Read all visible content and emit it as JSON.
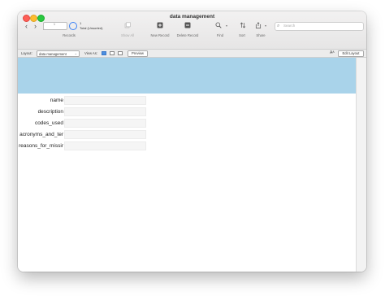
{
  "window": {
    "title": "data management"
  },
  "toolbar": {
    "record_current": "1",
    "record_total": "Total (Unsorted)",
    "records_label": "Records",
    "show_all_label": "Show All",
    "new_record_label": "New Record",
    "delete_record_label": "Delete Record",
    "find_label": "Find",
    "sort_label": "Sort",
    "share_label": "Share",
    "search_placeholder": "Search"
  },
  "layout_bar": {
    "layout_label": "Layout:",
    "layout_value": "data management",
    "view_as_label": "View As:",
    "preview_label": "Preview",
    "aa_label": "Aᴬ",
    "edit_layout_label": "Edit Layout"
  },
  "fields": [
    {
      "label": "name",
      "value": ""
    },
    {
      "label": "description",
      "value": ""
    },
    {
      "label": "codes_used",
      "value": ""
    },
    {
      "label": "acronyms_and_ter",
      "value": ""
    },
    {
      "label": "reasons_for_missir",
      "value": ""
    }
  ],
  "colors": {
    "header_band": "#a9d3ea",
    "accent": "#3b82f6"
  },
  "icons": {
    "back": "chevron-left-icon",
    "forward": "chevron-right-icon",
    "show_all": "stack-icon",
    "new_record": "plus-square-icon",
    "delete_record": "minus-square-icon",
    "find": "magnifier-icon",
    "sort": "sort-arrows-icon",
    "share": "share-icon"
  }
}
